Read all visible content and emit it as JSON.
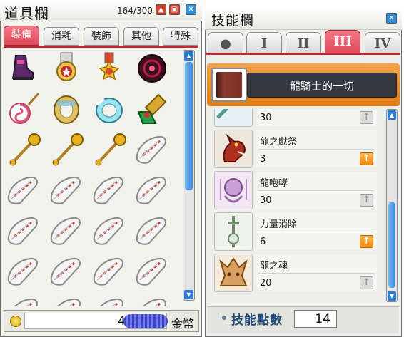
{
  "inventory": {
    "title": "道具欄",
    "slot_count": "164/300",
    "tabs": [
      "裝備",
      "消耗",
      "裝飾",
      "其他",
      "特殊"
    ],
    "active_tab": "裝備",
    "items": [
      {
        "name": "boots",
        "icon": "boots-icon"
      },
      {
        "name": "medal-red",
        "icon": "medal-red-icon"
      },
      {
        "name": "medal-star",
        "icon": "medal-star-icon"
      },
      {
        "name": "dark-sphere",
        "icon": "dark-sphere-icon"
      },
      {
        "name": "candy-wand",
        "icon": "candy-wand-icon"
      },
      {
        "name": "gold-ring",
        "icon": "gold-ring-icon"
      },
      {
        "name": "blue-ring",
        "icon": "blue-ring-icon"
      },
      {
        "name": "pendant-green",
        "icon": "pendant-icon"
      },
      {
        "name": "gold-mace",
        "icon": "mace-icon"
      },
      {
        "name": "gold-mace",
        "icon": "mace-icon"
      },
      {
        "name": "gold-mace",
        "icon": "mace-icon"
      },
      {
        "name": "white-cloak",
        "icon": "cloak-icon"
      },
      {
        "name": "white-cloak",
        "icon": "cloak-icon"
      },
      {
        "name": "white-cloak",
        "icon": "cloak-icon"
      },
      {
        "name": "white-cloak",
        "icon": "cloak-icon"
      },
      {
        "name": "white-cloak",
        "icon": "cloak-icon"
      },
      {
        "name": "white-cloak",
        "icon": "cloak-icon"
      },
      {
        "name": "white-cloak",
        "icon": "cloak-icon"
      },
      {
        "name": "white-cloak",
        "icon": "cloak-icon"
      },
      {
        "name": "white-cloak",
        "icon": "cloak-icon"
      },
      {
        "name": "white-cloak",
        "icon": "cloak-icon"
      },
      {
        "name": "white-cloak",
        "icon": "cloak-icon"
      },
      {
        "name": "white-cloak",
        "icon": "cloak-icon"
      },
      {
        "name": "white-cloak",
        "icon": "cloak-icon"
      }
    ],
    "money": "4,27",
    "currency_label": "金幣"
  },
  "skills": {
    "title": "技能欄",
    "tabs": [
      "●",
      "I",
      "II",
      "III",
      "IV"
    ],
    "active_tab": "III",
    "job_name": "龍騎士的一切",
    "list": [
      {
        "name": "",
        "level": "30",
        "can_raise": false,
        "icon": "dragon-crusher-icon"
      },
      {
        "name": "龍之獻祭",
        "level": "3",
        "can_raise": true,
        "icon": "dragon-sacrifice-icon"
      },
      {
        "name": "龍咆哮",
        "level": "30",
        "can_raise": false,
        "icon": "dragon-roar-icon"
      },
      {
        "name": "力量消除",
        "level": "6",
        "can_raise": true,
        "icon": "power-crash-icon"
      },
      {
        "name": "龍之魂",
        "level": "20",
        "can_raise": false,
        "icon": "dragon-blood-icon"
      }
    ],
    "points_label": "技能點數",
    "points": "14"
  },
  "colors": {
    "active_tab": "#e0495a",
    "accent_red": "#c32635",
    "scroll_blue": "#2a7ad0",
    "raise_orange": "#f08a10"
  }
}
